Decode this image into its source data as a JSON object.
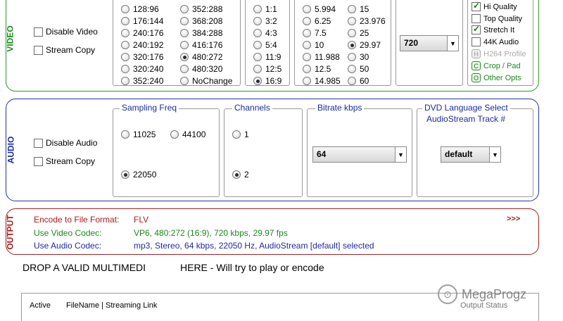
{
  "video": {
    "side_label": "VIDEO",
    "disable_label": "Disable Video",
    "stream_copy_label": "Stream Copy",
    "resolutions_col1": [
      "128:96",
      "176:144",
      "240:176",
      "240:192",
      "320:176",
      "320:240",
      "352:240"
    ],
    "resolutions_col2": [
      "352:288",
      "368:208",
      "384:288",
      "416:176",
      "480:272",
      "480:320",
      "NoChange"
    ],
    "resolution_selected": "480:272",
    "aspects": [
      "1:1",
      "3:2",
      "4:3",
      "5:4",
      "11:9",
      "12:5",
      "16:9"
    ],
    "aspect_selected": "16:9",
    "fps_col1": [
      "5.994",
      "6.25",
      "7.5",
      "10",
      "11.988",
      "12.5",
      "14.985"
    ],
    "fps_col2": [
      "15",
      "23.976",
      "25",
      "29.97",
      "30",
      "50",
      "60"
    ],
    "fps_selected": "29.97",
    "bitrate_value": "720",
    "options": [
      {
        "label": "Hi Quality",
        "checked": true
      },
      {
        "label": "Top Quality",
        "checked": false
      },
      {
        "label": "Stretch It",
        "checked": true
      },
      {
        "label": "44K Audio",
        "checked": false
      }
    ],
    "h264_label": "H264 Profile",
    "h264_icon": "H",
    "crop_label": "Crop / Pad",
    "crop_icon": "C",
    "other_label": "Other Opts",
    "other_icon": "O"
  },
  "audio": {
    "side_label": "AUDIO",
    "disable_label": "Disable Audio",
    "stream_copy_label": "Stream Copy",
    "sampling_title": "Sampling Freq",
    "sampling": [
      "11025",
      "44100",
      "22050"
    ],
    "sampling_selected": "22050",
    "channels_title": "Channels",
    "channels": [
      "1",
      "2"
    ],
    "channels_selected": "2",
    "bitrate_title": "Bitrate  kbps",
    "bitrate_value": "64",
    "dvd_title_line1": "DVD Language Select",
    "dvd_title_line2": "AudioStream  Track #",
    "dvd_value": "default"
  },
  "output": {
    "side_label": "OUTPUT",
    "format_label": "Encode to File Format:",
    "format_value": "FLV",
    "more": ">>>",
    "video_codec_label": "Use Video Codec:",
    "video_codec_value": "VP6,  480:272 (16:9),  720 kbps,  29.97 fps",
    "audio_codec_label": "Use Audio Codec:",
    "audio_codec_value": "mp3,  Stereo,  64 kbps,  22050 Hz,  AudioStream [default] selected"
  },
  "drop": {
    "left_text": "DROP A VALID MULTIMEDI",
    "right_text": "HERE - Will try to play or encode"
  },
  "list": {
    "col_active": "Active",
    "col_file": "FileName  |  Streaming Link",
    "col_status": "Output Status"
  },
  "watermark": {
    "text": "MegaProgz"
  },
  "colors": {
    "video": "#2a9a2a",
    "audio": "#2233aa",
    "output": "#a02020",
    "codec_text_green": "#1a8a1a",
    "codec_text_blue": "#1a2aa8"
  }
}
